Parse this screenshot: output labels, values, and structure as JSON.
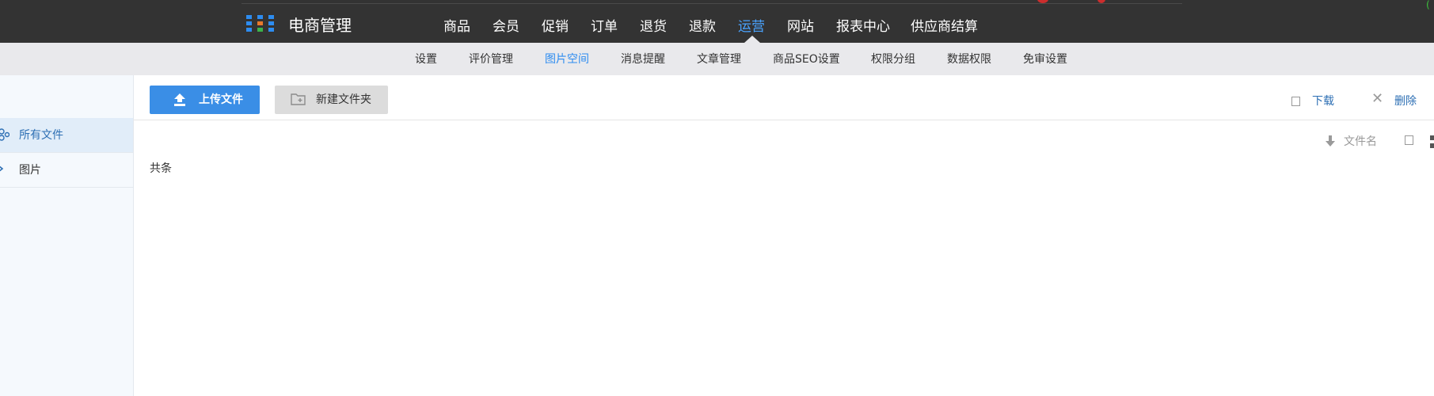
{
  "header": {
    "brand": "电商管理",
    "nav": [
      {
        "label": "商品"
      },
      {
        "label": "会员"
      },
      {
        "label": "促销"
      },
      {
        "label": "订单"
      },
      {
        "label": "退货"
      },
      {
        "label": "退款"
      },
      {
        "label": "运营",
        "active": true
      },
      {
        "label": "网站"
      },
      {
        "label": "报表中心"
      },
      {
        "label": "供应商结算"
      }
    ]
  },
  "subnav": [
    {
      "label": "设置"
    },
    {
      "label": "评价管理"
    },
    {
      "label": "图片空间",
      "active": true
    },
    {
      "label": "消息提醒"
    },
    {
      "label": "文章管理"
    },
    {
      "label": "商品SEO设置"
    },
    {
      "label": "权限分组"
    },
    {
      "label": "数据权限"
    },
    {
      "label": "免审设置"
    }
  ],
  "sidebar": {
    "items": [
      {
        "label": "所有文件",
        "active": true,
        "icon": "folder-tree-icon"
      },
      {
        "label": "图片",
        "icon": "image-icon"
      }
    ]
  },
  "toolbar": {
    "upload_label": "上传文件",
    "new_folder_label": "新建文件夹",
    "download_label": "下载",
    "delete_label": "删除"
  },
  "sort": {
    "label": "文件名"
  },
  "list": {
    "total_text": "共条"
  },
  "colors": {
    "topbar": "#333333",
    "accent": "#3a8ee6",
    "active_nav": "#4aa3ff",
    "subnav_bg": "#e9e9ec",
    "sidebar_bg": "#f5f9fd"
  }
}
